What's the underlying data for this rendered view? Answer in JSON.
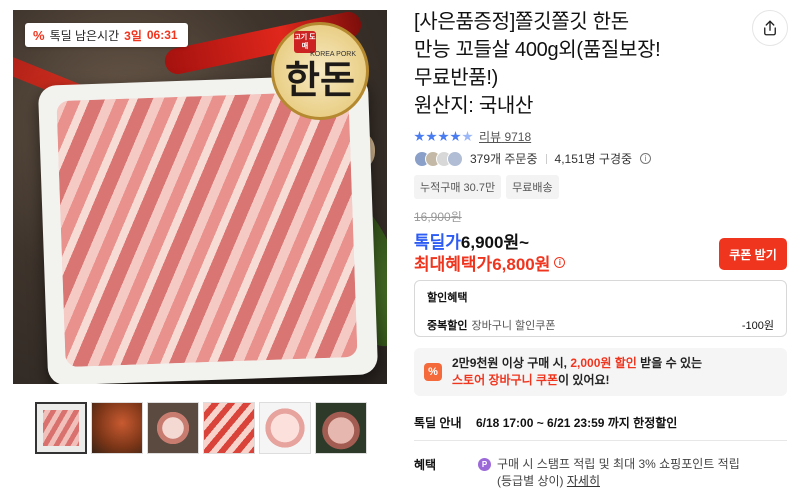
{
  "deal_tag": {
    "icon": "percent-icon",
    "label": "톡딜 남은시간",
    "days": "3일",
    "time": "06:31"
  },
  "logo": {
    "seal_text": "고기 도매",
    "main_text": "한돈",
    "sub_text": "KOREA PORK"
  },
  "thumbnails": [
    {
      "name": "thumb-1"
    },
    {
      "name": "thumb-2"
    },
    {
      "name": "thumb-3"
    },
    {
      "name": "thumb-4"
    },
    {
      "name": "thumb-5"
    },
    {
      "name": "thumb-6"
    }
  ],
  "product": {
    "title_lines": [
      "[사은품증정]쫄깃쫄깃 한돈",
      "만능 꼬들살 400g외(품질보장!",
      "무료반품!)",
      "원산지: 국내산"
    ]
  },
  "rating": {
    "stars": 4,
    "review_label": "리뷰",
    "review_count": "9718"
  },
  "social": {
    "orders": "379개 주문중",
    "subscribers": "4,151명 구경중"
  },
  "chips": [
    "누적구매 30.7만",
    "무료배송"
  ],
  "price": {
    "original": "16,900원",
    "talk_deal_label": "톡딜가",
    "talk_deal_value": "6,900원~",
    "max_benefit_label": "최대혜택가",
    "max_benefit_value": "6,800원",
    "coupon_button": "쿠폰 받기"
  },
  "discount": {
    "heading": "할인혜택",
    "row_label": "중복할인",
    "row_desc": "장바구니 할인쿠폰",
    "row_value": "-100원"
  },
  "promo": {
    "icon": "%",
    "line1_pre": "2만9천원 이상 구매 시, ",
    "line1_hl": "2,000원 할인",
    "line1_post": " 받을 수 있는",
    "line2_hl": "스토어 장바구니 쿠폰",
    "line2_post": "이 있어요!"
  },
  "deal_info": {
    "label": "톡딜 안내",
    "value": "6/18 17:00 ~ 6/21 23:59 까지 한정할인"
  },
  "benefit": {
    "label": "혜택",
    "badge": "P",
    "line1": "구매 시 스탬프 적립 및 최대 3% 쇼핑포인트 적립",
    "line2_pre": "(등급별 상이)",
    "line2_link": "자세히"
  },
  "colors": {
    "accent_red": "#f0351f",
    "talk_blue": "#2d5cf5",
    "star_blue": "#4a7cf1"
  }
}
